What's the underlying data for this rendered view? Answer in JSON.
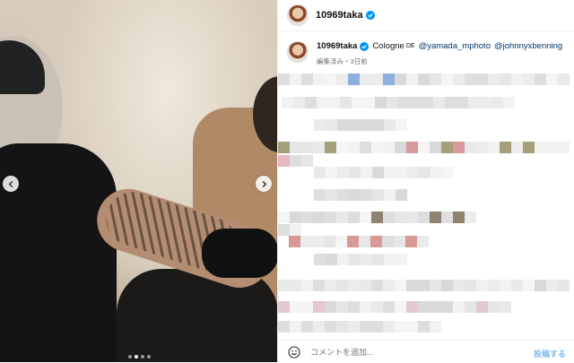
{
  "post": {
    "username": "10969taka",
    "caption_text": "Cologne",
    "caption_flag": "DE",
    "mentions": [
      "@yamada_mphoto",
      "@johnnyxbenning"
    ],
    "meta": "編集済み・3日前"
  },
  "carousel": {
    "dots": 4,
    "active_dot": 2
  },
  "comment": {
    "placeholder": "コメントを追加...",
    "post_label": "投稿する"
  },
  "colors": {
    "verified": "#0095f6",
    "mention": "#00376b",
    "post_button": "#7fb8ee"
  }
}
